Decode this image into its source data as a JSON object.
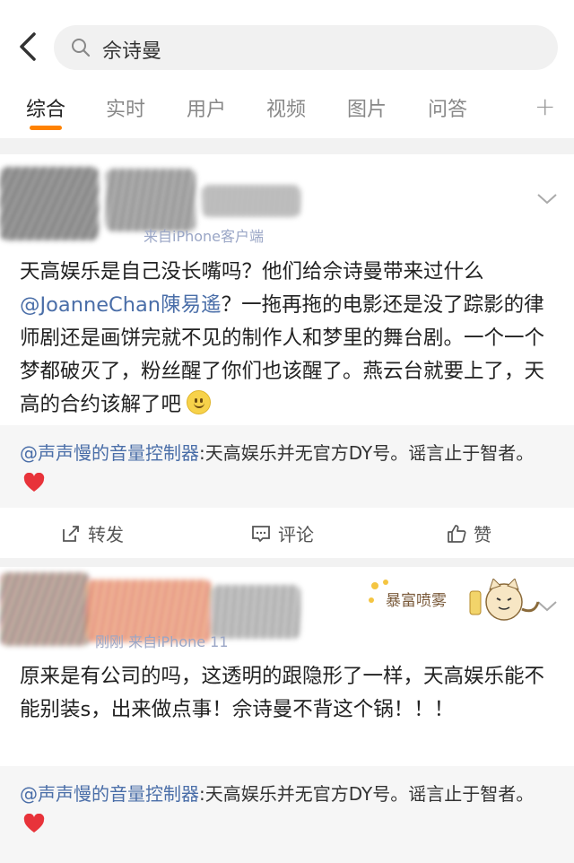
{
  "search": {
    "query": "佘诗曼"
  },
  "tabs": [
    {
      "label": "综合",
      "active": true
    },
    {
      "label": "实时"
    },
    {
      "label": "用户"
    },
    {
      "label": "视频"
    },
    {
      "label": "图片"
    },
    {
      "label": "问答"
    }
  ],
  "posts": [
    {
      "source": "来自iPhone客户端",
      "text_pre": "天高娱乐是自己没长嘴吗？他们给佘诗曼带来过什么",
      "mention": "@JoanneChan陳易遙",
      "text_post": "？一拖再拖的电影还是没了踪影的律师剧还是画饼完就不见的制作人和梦里的舞台剧。一个一个梦都破灭了，粉丝醒了你们也该醒了。燕云台就要上了，天高的合约该解了吧",
      "repost_user": "@声声慢的音量控制器",
      "repost_text": ":天高娱乐并无官方DY号。谣言止于智者。"
    },
    {
      "source": "刚刚 来自iPhone 11",
      "sticker": "暴富喷雾",
      "text": "原来是有公司的吗，这透明的跟隐形了一样，天高娱乐能不能别装s，出来做点事！佘诗曼不背这个锅！！！",
      "repost_user": "@声声慢的音量控制器",
      "repost_text": ":天高娱乐并无官方DY号。谣言止于智者。"
    }
  ],
  "actions": {
    "repost": "转发",
    "comment": "评论",
    "like": "赞"
  },
  "colors": {
    "accent": "#ff8200",
    "link": "#4a6ea8",
    "heart": "#e8333a"
  }
}
